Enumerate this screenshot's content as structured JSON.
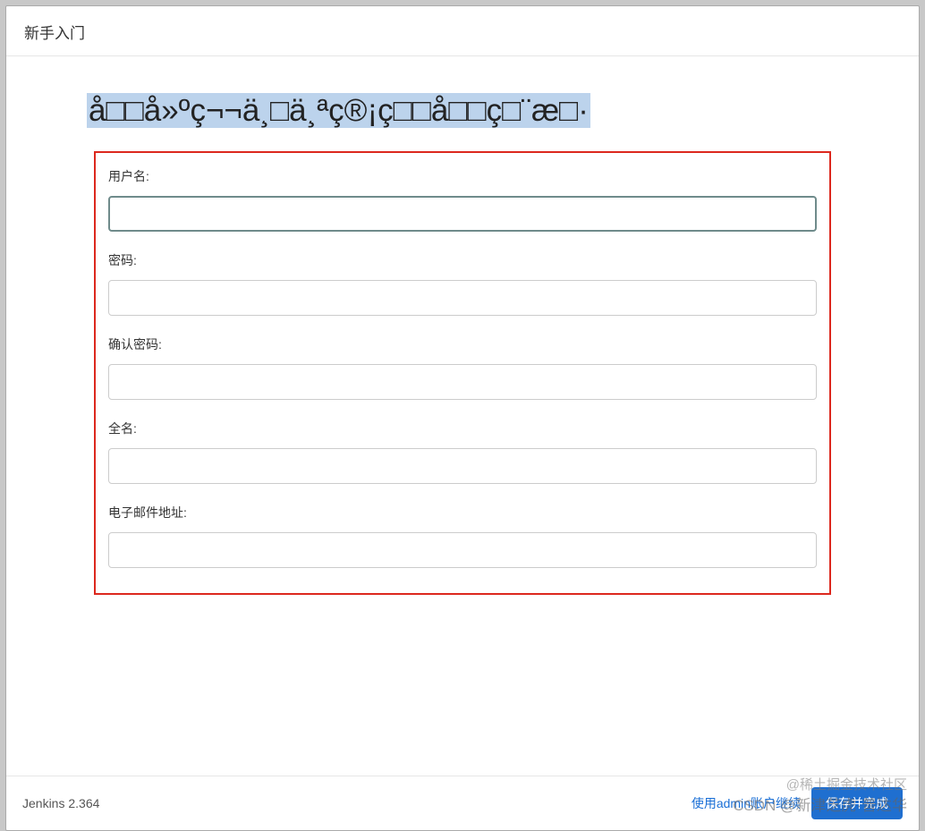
{
  "dialog": {
    "title": "新手入门",
    "garbled_heading": "å□□å»ºç¬¬ä¸□ä¸ªç®¡ç□□å□□ç□¨æ□·"
  },
  "form": {
    "username": {
      "label": "用户名:",
      "value": ""
    },
    "password": {
      "label": "密码:",
      "value": ""
    },
    "confirm_password": {
      "label": "确认密码:",
      "value": ""
    },
    "fullname": {
      "label": "全名:",
      "value": ""
    },
    "email": {
      "label": "电子邮件地址:",
      "value": ""
    }
  },
  "footer": {
    "version": "Jenkins 2.364",
    "skip_link": "使用admin账户继续",
    "save_button": "保存并完成"
  },
  "watermarks": {
    "top": "@稀土掘金技术社区",
    "bottom": "CSDN @新津芝虎·普达华"
  }
}
